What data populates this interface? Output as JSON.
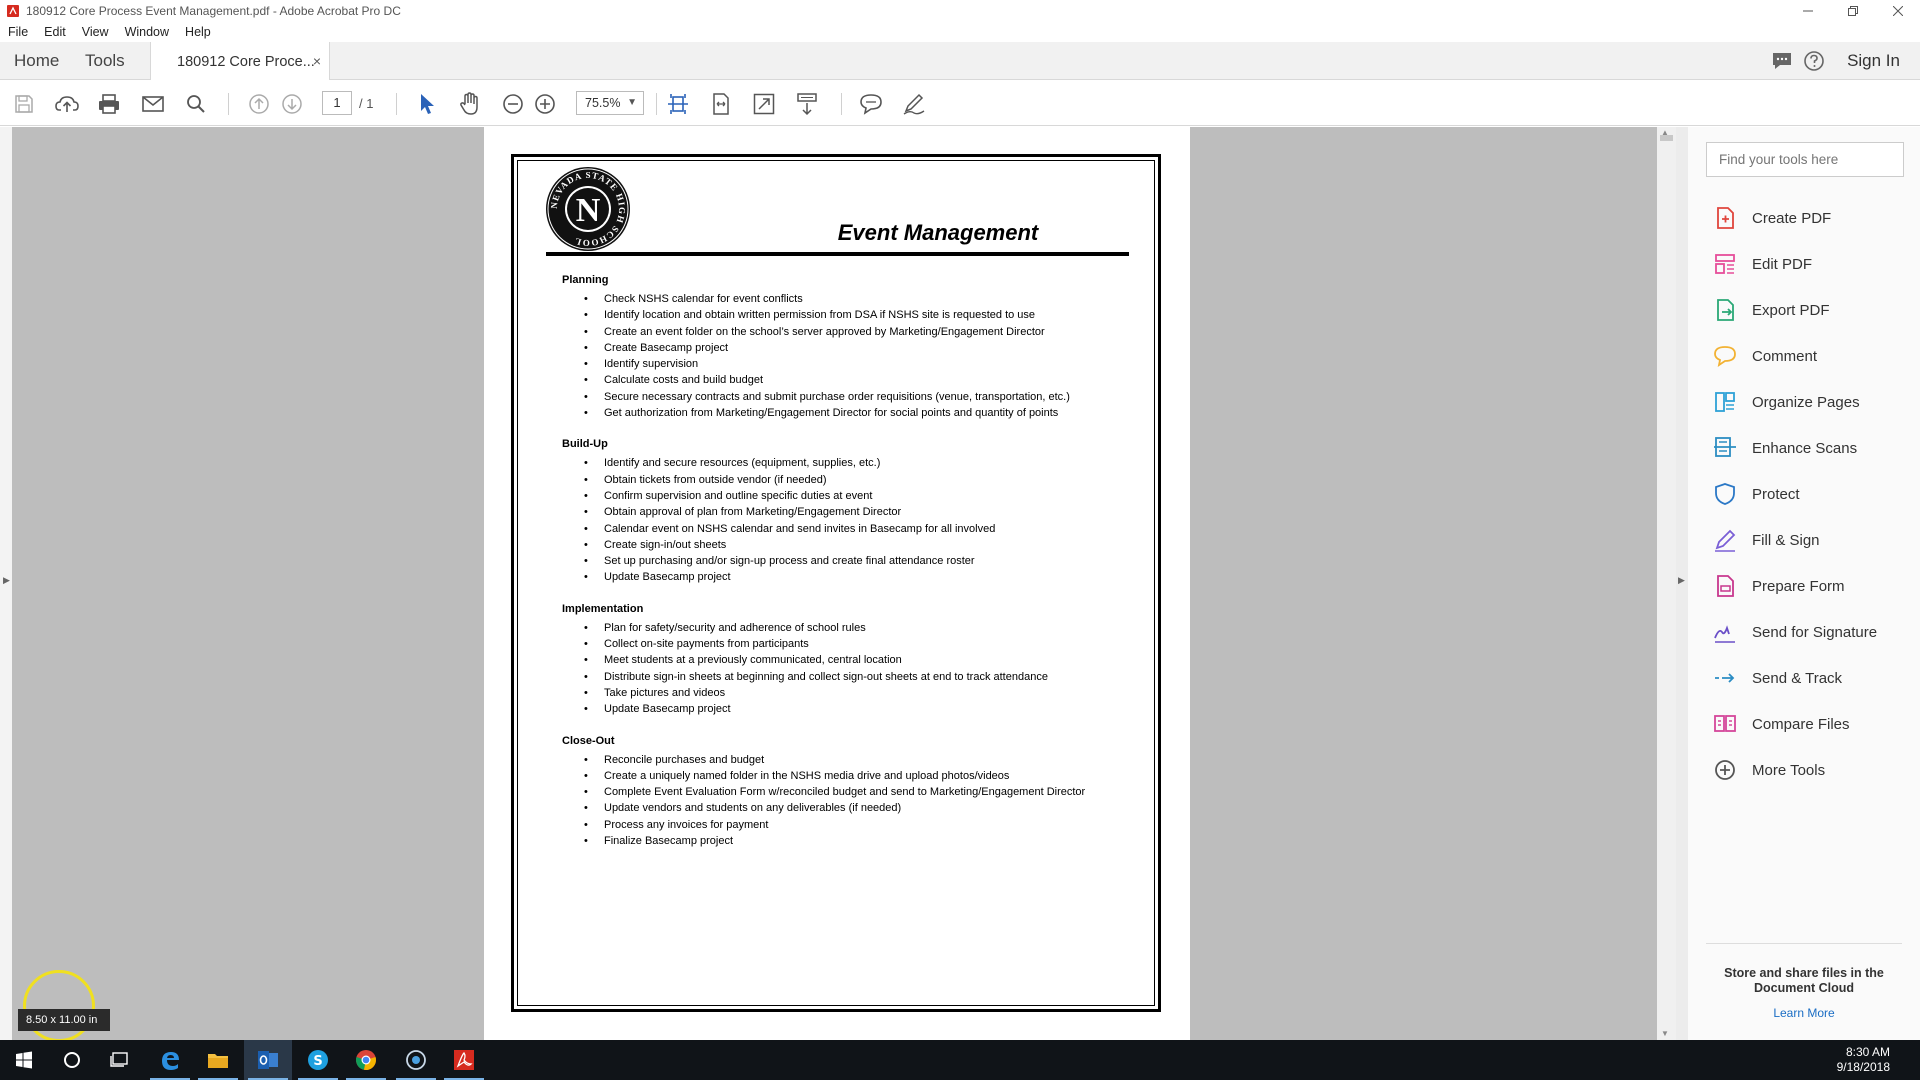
{
  "window": {
    "title": "180912 Core Process Event Management.pdf - Adobe Acrobat Pro DC",
    "minimize_icon": "minimize-icon",
    "maximize_icon": "restore-icon",
    "close_icon": "close-icon"
  },
  "menu": [
    "File",
    "Edit",
    "View",
    "Window",
    "Help"
  ],
  "tabs": {
    "home": "Home",
    "tools": "Tools",
    "document": "180912 Core Proce...",
    "close": "×",
    "sign_in": "Sign In"
  },
  "toolbar": {
    "page_current": "1",
    "page_total": "/ 1",
    "zoom": "75.5%",
    "icons": [
      "save-icon",
      "upload-icon",
      "print-icon",
      "email-icon",
      "search-icon",
      "prev-page-icon",
      "next-page-icon",
      "select-cursor-icon",
      "hand-icon",
      "zoom-out-icon",
      "zoom-in-icon",
      "fit-page-icon",
      "fit-width-icon",
      "full-screen-icon",
      "scroll-mode-icon",
      "comment-icon",
      "pen-icon"
    ]
  },
  "document": {
    "title": "Event Management",
    "seal_text": "NEVADA STATE HIGH SCHOOL",
    "seal_letter": "N",
    "sections": [
      {
        "heading": "Planning",
        "items": [
          "Check NSHS calendar for event conflicts",
          "Identify location and obtain written permission from DSA if NSHS site is requested to use",
          "Create an event folder on the school’s server approved by Marketing/Engagement Director",
          "Create Basecamp project",
          "Identify supervision",
          "Calculate costs and build budget",
          "Secure necessary contracts and submit purchase order requisitions (venue, transportation, etc.)",
          "Get authorization from Marketing/Engagement Director for social points and quantity of points"
        ]
      },
      {
        "heading": "Build-Up",
        "items": [
          "Identify and secure resources (equipment, supplies, etc.)",
          "Obtain tickets from outside vendor (if needed)",
          "Confirm supervision and outline specific duties at event",
          "Obtain approval of plan from Marketing/Engagement Director",
          "Calendar event on NSHS calendar and send invites in Basecamp for all involved",
          "Create sign-in/out sheets",
          "Set up purchasing and/or sign-up process and create final attendance roster",
          "Update Basecamp project"
        ]
      },
      {
        "heading": "Implementation",
        "items": [
          "Plan for safety/security and adherence of school rules",
          "Collect on-site payments from participants",
          "Meet students at a previously communicated, central location",
          "Distribute sign-in sheets at beginning and collect sign-out sheets at end to track attendance",
          "Take pictures and videos",
          "Update Basecamp project"
        ]
      },
      {
        "heading": "Close-Out",
        "items": [
          "Reconcile purchases and budget",
          "Create a uniquely named folder in the NSHS media drive and upload photos/videos",
          "Complete Event Evaluation Form w/reconciled budget and send to Marketing/Engagement Director",
          "Update vendors and students on any deliverables (if needed)",
          "Process any invoices for payment",
          "Finalize Basecamp project"
        ]
      }
    ]
  },
  "right_panel": {
    "search_placeholder": "Find your tools here",
    "tools": [
      {
        "label": "Create PDF",
        "icon": "create-pdf-icon",
        "color": "#e0453c"
      },
      {
        "label": "Edit PDF",
        "icon": "edit-pdf-icon",
        "color": "#e64e9a"
      },
      {
        "label": "Export PDF",
        "icon": "export-pdf-icon",
        "color": "#2aa876"
      },
      {
        "label": "Comment",
        "icon": "comment-icon",
        "color": "#f2b233"
      },
      {
        "label": "Organize Pages",
        "icon": "organize-pages-icon",
        "color": "#2ea1d6"
      },
      {
        "label": "Enhance Scans",
        "icon": "enhance-scans-icon",
        "color": "#2c8ec2"
      },
      {
        "label": "Protect",
        "icon": "protect-icon",
        "color": "#2b78c6"
      },
      {
        "label": "Fill & Sign",
        "icon": "fill-sign-icon",
        "color": "#7a5fd6"
      },
      {
        "label": "Prepare Form",
        "icon": "prepare-form-icon",
        "color": "#c8378e"
      },
      {
        "label": "Send for Signature",
        "icon": "send-signature-icon",
        "color": "#6a4fc8"
      },
      {
        "label": "Send & Track",
        "icon": "send-track-icon",
        "color": "#2a8cc4"
      },
      {
        "label": "Compare Files",
        "icon": "compare-files-icon",
        "color": "#d5479a"
      },
      {
        "label": "More Tools",
        "icon": "more-tools-icon",
        "color": "#555555"
      }
    ],
    "cloud_text": "Store and share files in the Document Cloud",
    "cloud_link": "Learn More"
  },
  "tooltip": "8.50 x 11.00 in",
  "taskbar": {
    "items": [
      "windows-start-icon",
      "cortana-search-icon",
      "task-view-icon",
      "edge-icon",
      "file-explorer-icon",
      "outlook-icon",
      "skype-icon",
      "chrome-icon",
      "app-circle-icon",
      "acrobat-icon"
    ],
    "time": "8:30 AM",
    "date": "9/18/2018"
  }
}
